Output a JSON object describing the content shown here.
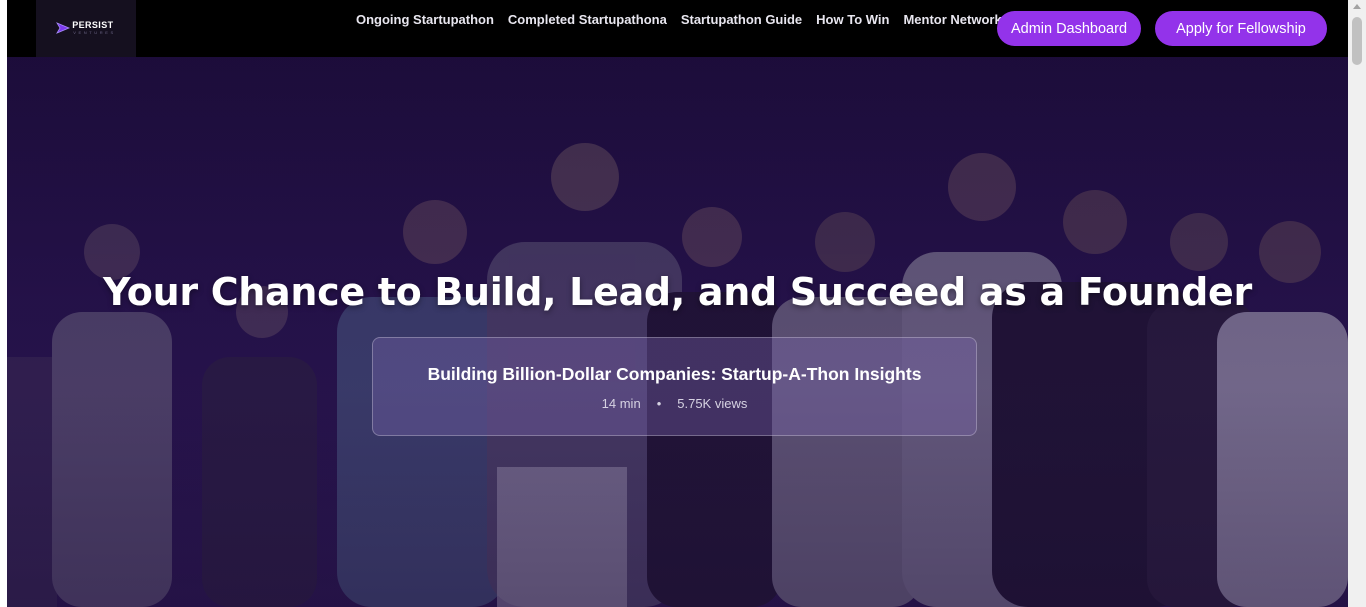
{
  "brand": {
    "name": "PERSIST",
    "sub": "VENTURES"
  },
  "nav": {
    "links": [
      "Ongoing Startupathon",
      "Completed Startupathona",
      "Startupathon Guide",
      "How To Win",
      "Mentor Network"
    ],
    "admin_button": "Admin Dashboard",
    "apply_button": "Apply for Fellowship"
  },
  "hero": {
    "title": "Your Chance to Build, Lead, and Succeed as a Founder",
    "video": {
      "title": "Building Billion-Dollar Companies: Startup-A-Thon Insights",
      "duration": "14 min",
      "separator": "•",
      "views": "5.75K views"
    }
  },
  "colors": {
    "accent": "#9333ea",
    "nav_bg": "#000000",
    "hero_overlay": "#24104a"
  },
  "icons": [
    "logo-arrow-icon",
    "scroll-up-arrow-icon"
  ]
}
